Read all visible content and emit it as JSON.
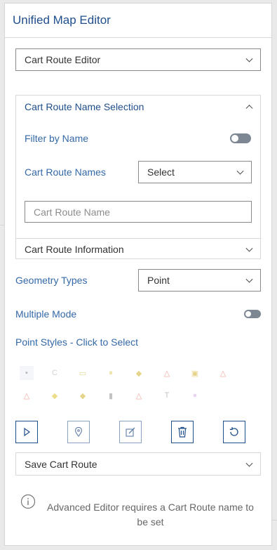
{
  "panel": {
    "title": "Unified Map Editor"
  },
  "editor_select": {
    "value": "Cart Route Editor"
  },
  "name_selection": {
    "header": "Cart Route Name Selection",
    "filter_label": "Filter by Name",
    "names_label": "Cart Route Names",
    "names_select_value": "Select",
    "name_input_placeholder": "Cart Route Name"
  },
  "route_info": {
    "header": "Cart Route Information"
  },
  "geometry": {
    "label": "Geometry Types",
    "value": "Point"
  },
  "multiple_mode": {
    "label": "Multiple Mode"
  },
  "point_styles": {
    "label": "Point Styles - Click to Select",
    "icons": [
      {
        "name": "box-icon",
        "glyph": "▪",
        "color": "#8a8a8a"
      },
      {
        "name": "c-icon",
        "glyph": "C",
        "color": "#9a9a9a"
      },
      {
        "name": "sign-icon",
        "glyph": "▭",
        "color": "#b8a800"
      },
      {
        "name": "pause-sign-icon",
        "glyph": "⏸",
        "color": "#c8b000"
      },
      {
        "name": "diamond-sign-icon",
        "glyph": "◆",
        "color": "#c9a200"
      },
      {
        "name": "warning-triangle-icon",
        "glyph": "△",
        "color": "#d2322d"
      },
      {
        "name": "square-sign-icon",
        "glyph": "▣",
        "color": "#c8a000"
      },
      {
        "name": "warning-triangle-small-icon",
        "glyph": "△",
        "color": "#d2322d"
      },
      {
        "name": "warning-triangle-alt-icon",
        "glyph": "△",
        "color": "#d2322d"
      },
      {
        "name": "diamond-yellow-icon",
        "glyph": "◆",
        "color": "#d9b400"
      },
      {
        "name": "diamond-arrow-icon",
        "glyph": "◆",
        "color": "#c9a200"
      },
      {
        "name": "cup-icon",
        "glyph": "▮",
        "color": "#7a7a7a"
      },
      {
        "name": "warning-triangle-red-icon",
        "glyph": "△",
        "color": "#d2322d"
      },
      {
        "name": "t-icon",
        "glyph": "T",
        "color": "#7a7a7a"
      },
      {
        "name": "circle-purple-icon",
        "glyph": "●",
        "color": "#c8a2e0"
      }
    ]
  },
  "tools": {
    "select_icon": "cursor-icon",
    "pin_icon": "map-pin-icon",
    "edit_icon": "edit-square-icon",
    "delete_icon": "trash-icon",
    "reset_icon": "refresh-icon"
  },
  "save_route": {
    "header": "Save Cart Route"
  },
  "info": {
    "message": "Advanced Editor requires a Cart Route name to be set"
  },
  "colors": {
    "accent": "#1f4e8c",
    "label_blue": "#3469a8",
    "toggle_off": "#7d8794"
  }
}
